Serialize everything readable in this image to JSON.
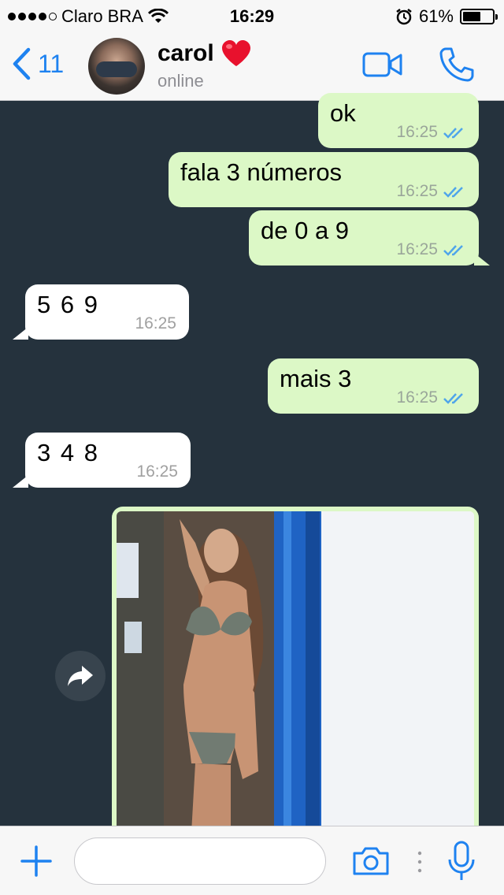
{
  "status_bar": {
    "carrier": "Claro BRA",
    "time": "16:29",
    "battery_percent_label": "61%",
    "battery_level": 0.61,
    "icons": [
      "signal-dots",
      "wifi-icon",
      "alarm-icon",
      "battery-icon"
    ]
  },
  "header": {
    "back_count": "11",
    "contact_name": "carol",
    "contact_emoji": "❤️",
    "contact_status": "online",
    "icons": [
      "back-chevron-icon",
      "video-call-icon",
      "phone-icon"
    ]
  },
  "messages": [
    {
      "direction": "out",
      "text": "ok",
      "time": "16:25",
      "read": true
    },
    {
      "direction": "out",
      "text": "fala 3 números",
      "time": "16:25",
      "read": true
    },
    {
      "direction": "out",
      "text": "de 0 a 9",
      "time": "16:25",
      "read": true
    },
    {
      "direction": "in",
      "text": "5 6 9",
      "time": "16:25"
    },
    {
      "direction": "out",
      "text": "mais 3",
      "time": "16:25",
      "read": true
    },
    {
      "direction": "in",
      "text": "3 4 8",
      "time": "16:25"
    },
    {
      "direction": "out",
      "type": "photo"
    }
  ],
  "input_bar": {
    "placeholder": "",
    "icons": [
      "plus-icon",
      "camera-icon",
      "more-dots-icon",
      "microphone-icon"
    ]
  },
  "colors": {
    "accent": "#1e82f0",
    "chat_background": "#25323d",
    "outgoing_bubble": "#dcf8c6",
    "incoming_bubble": "#ffffff",
    "read_ticks": "#4fa5ea"
  }
}
